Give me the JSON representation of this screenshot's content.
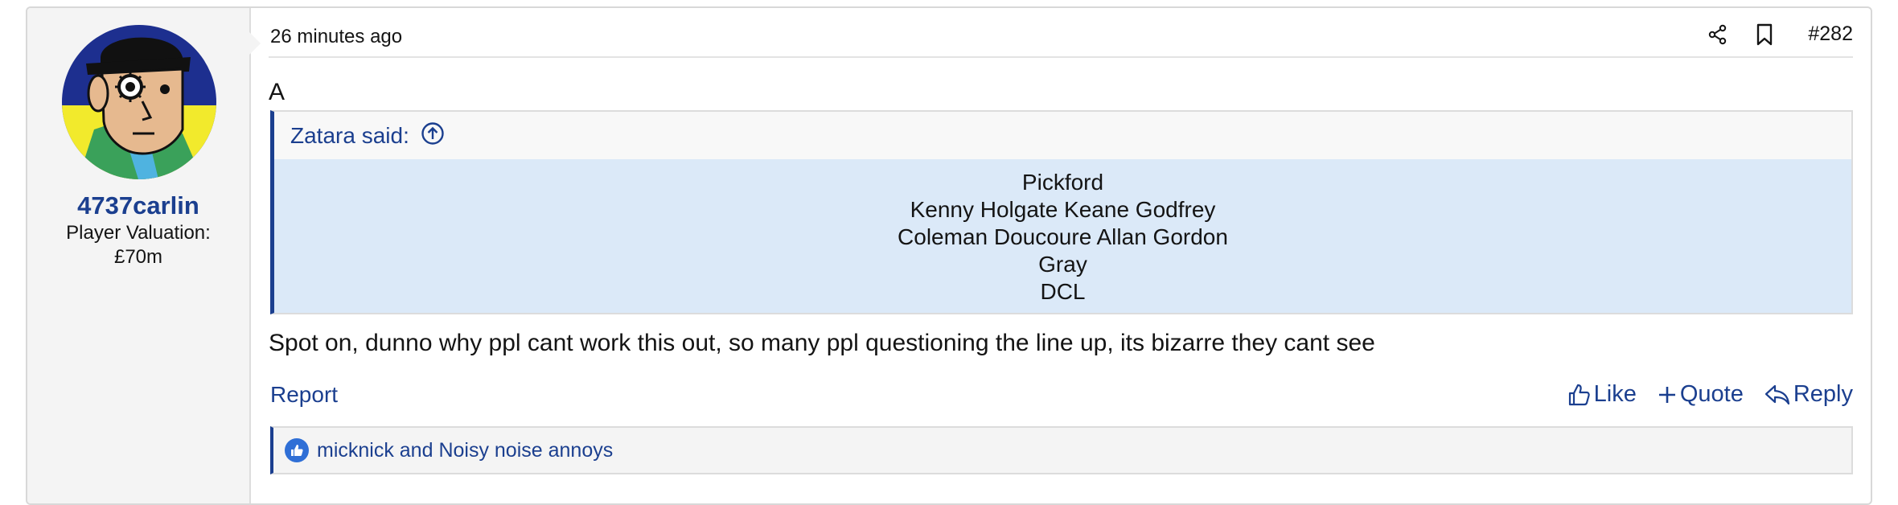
{
  "user": {
    "name": "4737carlin",
    "title_line1": "Player Valuation:",
    "title_line2": "£70m"
  },
  "post": {
    "timestamp": "26 minutes ago",
    "number": "#282",
    "top_text": "A",
    "reply_text": "Spot on, dunno why ppl cant work this out, so many ppl questioning the line up, its bizarre they cant see"
  },
  "quote": {
    "author": "Zatara said:",
    "lines": [
      "Pickford",
      "Kenny Holgate Keane Godfrey",
      "Coleman Doucoure Allan Gordon",
      "Gray",
      "DCL"
    ]
  },
  "actions": {
    "report": "Report",
    "like": "Like",
    "quote": "Quote",
    "reply": "Reply"
  },
  "reactions": {
    "text": "micknick and Noisy noise annoys"
  },
  "icons": {
    "share": "share-icon",
    "bookmark": "bookmark-icon",
    "like": "thumbs-up-icon",
    "quote": "plus-icon",
    "reply": "reply-icon",
    "quote_expand": "arrow-up-circle-icon",
    "reaction": "thumbs-up-badge-icon"
  },
  "colors": {
    "link": "#1b3f8f",
    "quote_bg": "#dbe9f8",
    "sidebar_bg": "#f4f4f4",
    "reaction_badge": "#2f6fd6"
  }
}
